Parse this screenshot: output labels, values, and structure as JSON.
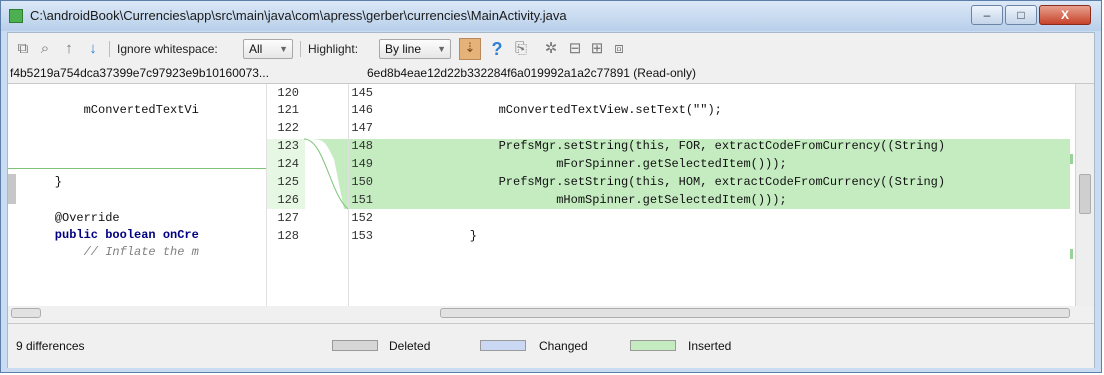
{
  "window": {
    "title": "C:\\androidBook\\Currencies\\app\\src\\main\\java\\com\\apress\\gerber\\currencies\\MainActivity.java",
    "minimize_label": "‒",
    "maximize_label": "□",
    "close_label": "X"
  },
  "toolbar": {
    "ignore_whitespace_label": "Ignore whitespace:",
    "ignore_whitespace_value": "All",
    "highlight_label": "Highlight:",
    "highlight_value": "By line",
    "icons": [
      "copy-icon",
      "find-icon",
      "previous-difference-icon",
      "next-difference-icon",
      "synchronize-scroll-icon",
      "help-icon",
      "edit-source-icon",
      "settings-icon",
      "apply-left-icon",
      "apply-right-icon",
      "compare-icon"
    ]
  },
  "revisions": {
    "left": "f4b5219a754dca37399e7c97923e9b10160073...",
    "right": "6ed8b4eae12d22b332284f6a019992a1a2c77891 (Read-only)"
  },
  "left_lines": [
    {
      "num": "120",
      "text": ""
    },
    {
      "num": "121",
      "text": "        mConvertedTextVi"
    },
    {
      "num": "122",
      "text": ""
    },
    {
      "num": "123",
      "text": ""
    },
    {
      "num": "124",
      "text": "    }"
    },
    {
      "num": "125",
      "text": ""
    },
    {
      "num": "126",
      "text": "    @Override"
    },
    {
      "num": "127",
      "text": "    public boolean onCre"
    },
    {
      "num": "128",
      "text": "        // Inflate the m"
    }
  ],
  "right_lines": [
    {
      "num": "145",
      "text": ""
    },
    {
      "num": "146",
      "text": "        mConvertedTextView.setText(\"\");"
    },
    {
      "num": "147",
      "text": ""
    },
    {
      "num": "148",
      "text": "        PrefsMgr.setString(this, FOR, extractCodeFromCurrency((String)"
    },
    {
      "num": "149",
      "text": "                mForSpinner.getSelectedItem()));"
    },
    {
      "num": "150",
      "text": "        PrefsMgr.setString(this, HOM, extractCodeFromCurrency((String)"
    },
    {
      "num": "151",
      "text": "                mHomSpinner.getSelectedItem()));"
    },
    {
      "num": "152",
      "text": ""
    },
    {
      "num": "153",
      "text": "    }"
    }
  ],
  "status": {
    "differences": "9 differences",
    "legend": [
      {
        "label": "Deleted",
        "color": "#d6d6d6"
      },
      {
        "label": "Changed",
        "color": "#cad8f3"
      },
      {
        "label": "Inserted",
        "color": "#c4ecc0"
      }
    ]
  }
}
